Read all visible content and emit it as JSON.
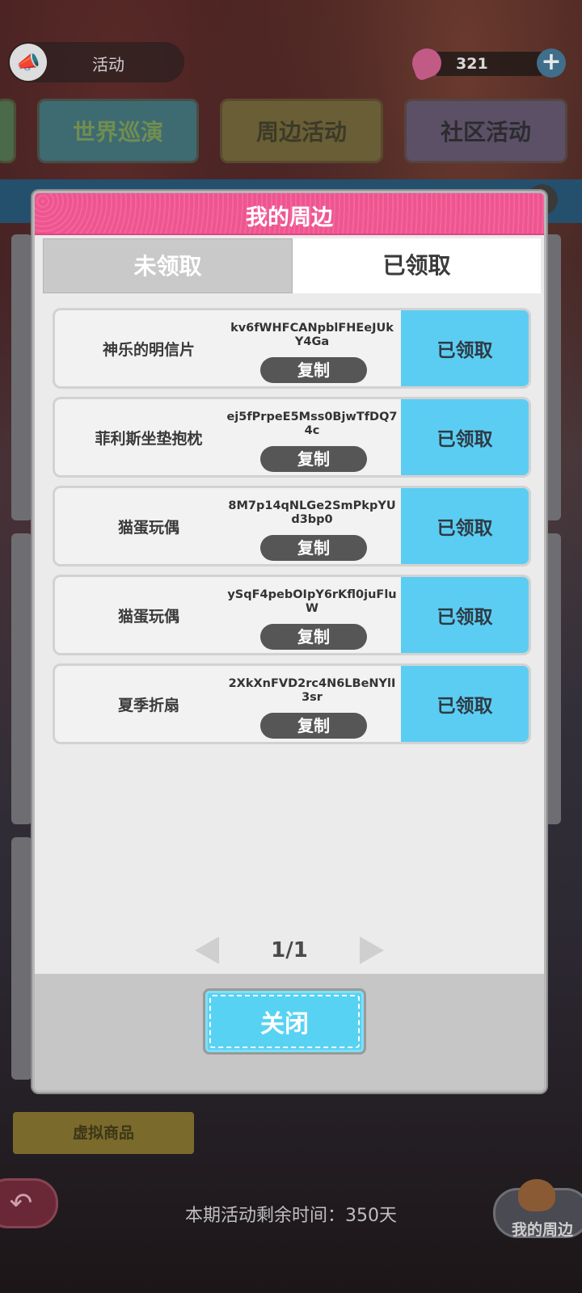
{
  "background": {
    "activity_label": "活动",
    "currency": "321",
    "banners": [
      "世界巡演",
      "周边活动",
      "社区活动"
    ],
    "virtual_goods_label": "虚拟商品",
    "remaining_time": "本期活动剩余时间：350天",
    "my_merch_button": "我的周边"
  },
  "modal": {
    "title": "我的周边",
    "tabs": [
      {
        "label": "未领取",
        "active": false
      },
      {
        "label": "已领取",
        "active": true
      }
    ],
    "items": [
      {
        "name": "神乐的明信片",
        "code": "kv6fWHFCANpblFHEeJUkY4Ga",
        "copy_label": "复制",
        "status": "已领取"
      },
      {
        "name": "菲利斯坐垫抱枕",
        "code": "ej5fPrpeE5Mss0BjwTfDQ74c",
        "copy_label": "复制",
        "status": "已领取"
      },
      {
        "name": "猫蛋玩偶",
        "code": "8M7p14qNLGe2SmPkpYUd3bp0",
        "copy_label": "复制",
        "status": "已领取"
      },
      {
        "name": "猫蛋玩偶",
        "code": "ySqF4pebOIpY6rKfl0juFluW",
        "copy_label": "复制",
        "status": "已领取"
      },
      {
        "name": "夏季折扇",
        "code": "2XkXnFVD2rc4N6LBeNYlI3sr",
        "copy_label": "复制",
        "status": "已领取"
      }
    ],
    "pagination": "1/1",
    "close_label": "关闭"
  },
  "colors": {
    "header_pink": "#ef5a92",
    "claimed_blue": "#5ccdf2",
    "close_button": "#58d2f3"
  },
  "icons": [
    "megaphone-icon",
    "gem-icon",
    "plus-icon",
    "info-icon",
    "back-arrow-icon",
    "prev-page-icon",
    "next-page-icon"
  ]
}
